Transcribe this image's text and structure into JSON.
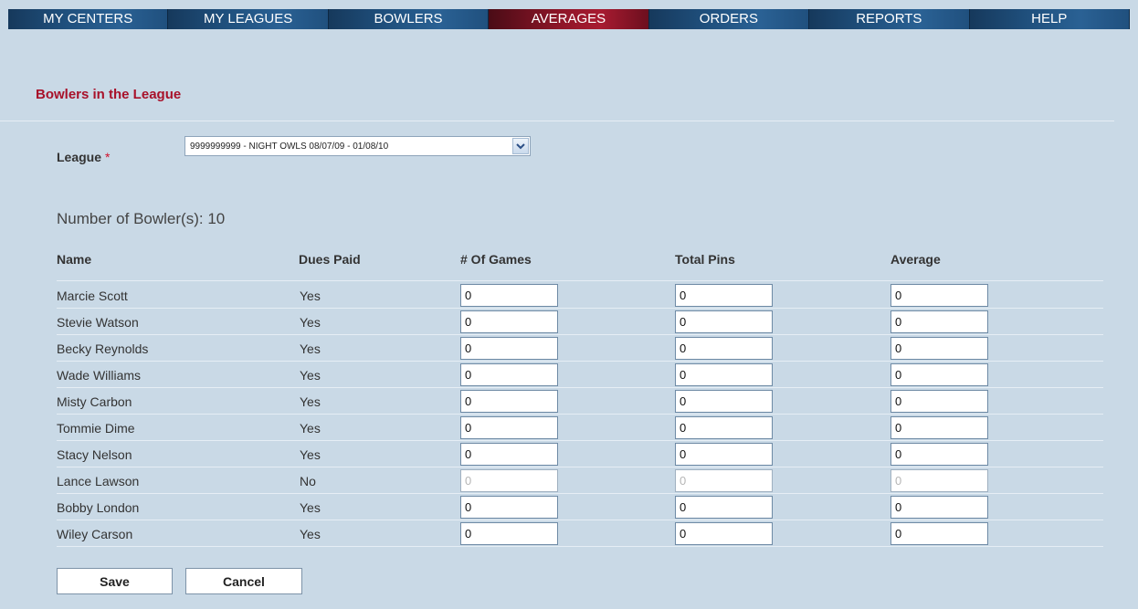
{
  "nav": {
    "items": [
      {
        "label": "MY CENTERS",
        "active": false
      },
      {
        "label": "MY LEAGUES",
        "active": false
      },
      {
        "label": "BOWLERS",
        "active": false
      },
      {
        "label": "AVERAGES",
        "active": true
      },
      {
        "label": "ORDERS",
        "active": false
      },
      {
        "label": "REPORTS",
        "active": false
      },
      {
        "label": "HELP",
        "active": false
      }
    ]
  },
  "page": {
    "title": "Bowlers in the League",
    "league_label": "League",
    "required_mark": "*",
    "league_value": "9999999999 - NIGHT OWLS  08/07/09 - 01/08/10",
    "count_text": "Number of Bowler(s): 10"
  },
  "table": {
    "headers": {
      "name": "Name",
      "dues": "Dues Paid",
      "games": "# Of Games",
      "pins": "Total Pins",
      "average": "Average"
    },
    "rows": [
      {
        "name": "Marcie Scott",
        "dues": "Yes",
        "games": "0",
        "pins": "0",
        "average": "0",
        "disabled": false
      },
      {
        "name": "Stevie Watson",
        "dues": "Yes",
        "games": "0",
        "pins": "0",
        "average": "0",
        "disabled": false
      },
      {
        "name": "Becky Reynolds",
        "dues": "Yes",
        "games": "0",
        "pins": "0",
        "average": "0",
        "disabled": false
      },
      {
        "name": "Wade Williams",
        "dues": "Yes",
        "games": "0",
        "pins": "0",
        "average": "0",
        "disabled": false
      },
      {
        "name": "Misty Carbon",
        "dues": "Yes",
        "games": "0",
        "pins": "0",
        "average": "0",
        "disabled": false
      },
      {
        "name": "Tommie Dime",
        "dues": "Yes",
        "games": "0",
        "pins": "0",
        "average": "0",
        "disabled": false
      },
      {
        "name": "Stacy Nelson",
        "dues": "Yes",
        "games": "0",
        "pins": "0",
        "average": "0",
        "disabled": false
      },
      {
        "name": "Lance Lawson",
        "dues": "No",
        "games": "0",
        "pins": "0",
        "average": "0",
        "disabled": true
      },
      {
        "name": "Bobby London",
        "dues": "Yes",
        "games": "0",
        "pins": "0",
        "average": "0",
        "disabled": false
      },
      {
        "name": "Wiley Carson",
        "dues": "Yes",
        "games": "0",
        "pins": "0",
        "average": "0",
        "disabled": false
      }
    ]
  },
  "buttons": {
    "save": "Save",
    "cancel": "Cancel"
  },
  "colors": {
    "nav_blue": "#1f4f7c",
    "nav_active": "#8e1528",
    "title_red": "#a8112a",
    "background": "#c9d9e6"
  }
}
